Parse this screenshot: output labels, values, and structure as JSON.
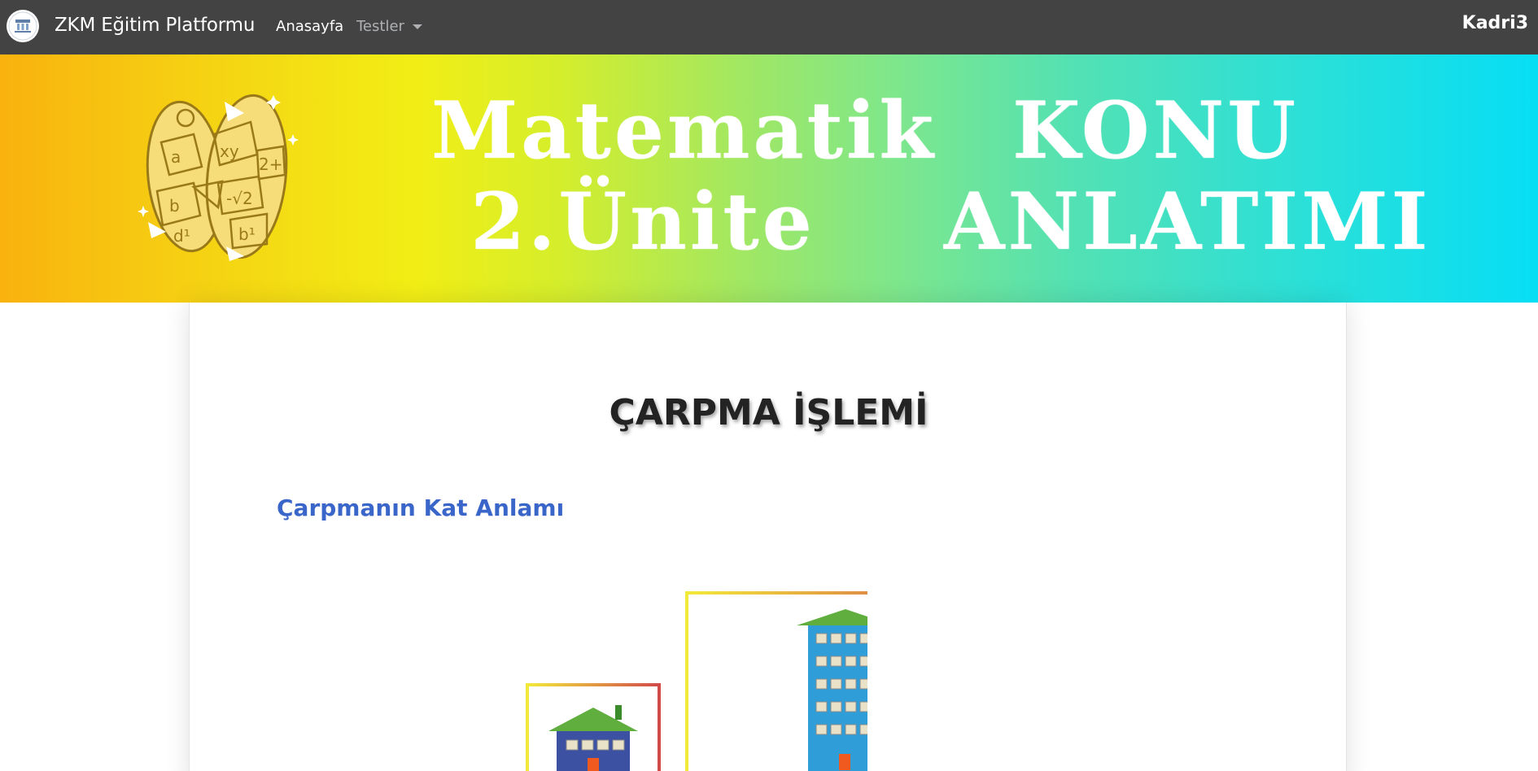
{
  "navbar": {
    "brand": "ZKM Eğitim Platformu",
    "home_label": "Anasayfa",
    "tests_label": "Testler",
    "user_label": "Kadri3",
    "logo_icon": "school-logo-icon"
  },
  "banner": {
    "line1_left": "Matematik",
    "line2_left": "2.Ünite",
    "line1_right": "KONU",
    "line2_right": "ANLATIMI",
    "logo_icon": "math-m-logo-icon",
    "logo_symbols": [
      "a",
      "b",
      "xy",
      "2+",
      "-√2",
      "b¹",
      "d¹",
      "a"
    ]
  },
  "content": {
    "title": "ÇARPMA İŞLEMİ",
    "subtitle": "Çarpmanın Kat Anlamı",
    "illustration_icon": "buildings-illustration-icon"
  },
  "colors": {
    "navbar_bg": "#434343",
    "subtitle": "#3b66c9",
    "title": "#232323"
  }
}
